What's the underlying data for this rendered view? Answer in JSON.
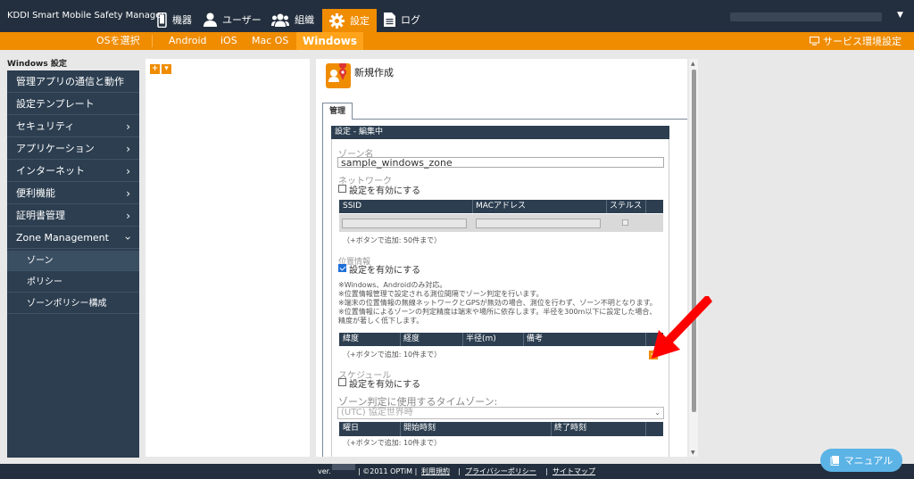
{
  "brand": "KDDI Smart Mobile Safety Manager",
  "topnav": [
    {
      "label": "機器",
      "icon": "phone-icon"
    },
    {
      "label": "ユーザー",
      "icon": "user-icon"
    },
    {
      "label": "組織",
      "icon": "group-icon"
    },
    {
      "label": "設定",
      "icon": "gear-icon",
      "active": true
    },
    {
      "label": "ログ",
      "icon": "document-icon"
    }
  ],
  "subnav": {
    "select_os": "OSを選択",
    "items": [
      "Android",
      "iOS",
      "Mac OS",
      "Windows"
    ],
    "active": "Windows",
    "service_settings": "サービス環境設定"
  },
  "sidebar": {
    "title": "Windows 設定",
    "items": [
      {
        "label": "管理アプリの通信と動作",
        "chevron": false
      },
      {
        "label": "設定テンプレート",
        "chevron": false
      },
      {
        "label": "セキュリティ",
        "chevron": true
      },
      {
        "label": "アプリケーション",
        "chevron": true
      },
      {
        "label": "インターネット",
        "chevron": true
      },
      {
        "label": "便利機能",
        "chevron": true
      },
      {
        "label": "証明書管理",
        "chevron": true
      },
      {
        "label": "Zone Management",
        "chevron": "down"
      }
    ],
    "subitems": [
      {
        "label": "ゾーン",
        "active": true
      },
      {
        "label": "ポリシー",
        "active": false
      },
      {
        "label": "ゾーンポリシー構成",
        "active": false
      }
    ]
  },
  "tree": {
    "add_button": "+",
    "dropdown_button": "▾"
  },
  "main": {
    "title": "新規作成",
    "tab": "管理",
    "section_header": "設定 - 編集中",
    "zone_name_label": "ゾーン名",
    "zone_name_value": "sample_windows_zone",
    "network_label": "ネットワーク",
    "network_enable": "設定を有効にする",
    "network_columns": [
      "SSID",
      "MACアドレス",
      "ステルス"
    ],
    "network_hint": "（+ボタンで追加: 50件まで）",
    "location_label": "位置情報",
    "location_enable": "設定を有効にする",
    "location_notes": [
      "※Windows、Androidのみ対応。",
      "※位置情報管理で設定される測位間隔でゾーン判定を行います。",
      "※端末の位置情報の無線ネットワークとGPSが無効の場合、測位を行わず、ゾーン不明となります。",
      "※位置情報によるゾーンの判定精度は端末や場所に依存します。半径を300m以下に設定した場合、",
      "精度が著しく低下します。"
    ],
    "location_columns": [
      "緯度",
      "経度",
      "半径(m)",
      "備考"
    ],
    "location_hint": "（+ボタンで追加: 10件まで）",
    "schedule_label": "スケジュール",
    "schedule_enable": "設定を有効にする",
    "timezone_label": "ゾーン判定に使用するタイムゾーン:",
    "timezone_value": "(UTC) 協定世界時",
    "schedule_columns": [
      "曜日",
      "開始時刻",
      "終了時刻"
    ],
    "schedule_hint": "（+ボタンで追加: 10件まで）",
    "location_enabled": true,
    "network_enabled": false,
    "schedule_enabled": false
  },
  "footer": {
    "ver": "ver.",
    "copyright": "| ©2011 OPTiM |",
    "terms": "利用規約",
    "privacy": "プライバシーポリシー",
    "sitemap": "サイトマップ",
    "sep": "|"
  },
  "manual_button": "マニュアル",
  "colors": {
    "topbar": "#232f3e",
    "accent": "#f08c00",
    "sidebar": "#2c3e50",
    "manual": "#5bb3e6",
    "arrow": "#ff0000"
  }
}
